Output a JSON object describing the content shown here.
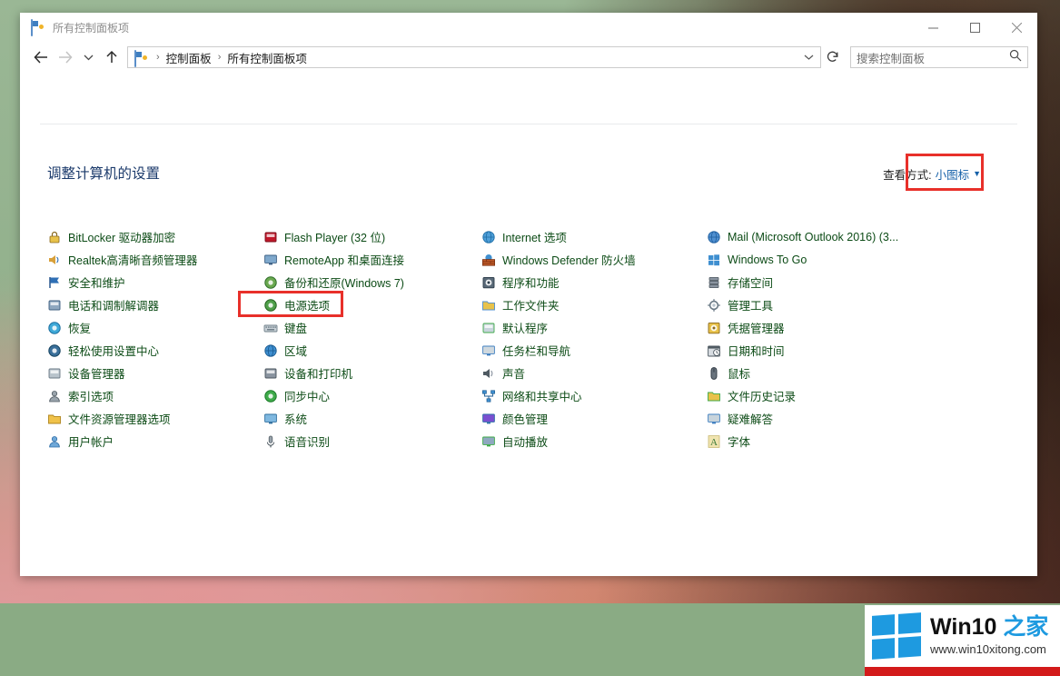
{
  "window": {
    "title": "所有控制面板项",
    "controls": {
      "minimize": "最小化",
      "maximize": "最大化",
      "close": "关闭"
    }
  },
  "nav": {
    "back": "后退",
    "forward": "前进",
    "recent": "最近浏览的位置",
    "up": "上移到",
    "breadcrumb": [
      "控制面板",
      "所有控制面板项"
    ],
    "separator": "›",
    "refresh": "刷新"
  },
  "search": {
    "placeholder": "搜索控制面板",
    "icon": "search-icon"
  },
  "header": {
    "page_title": "调整计算机的设置",
    "view_by_label": "查看方式:",
    "view_by_value": "小图标",
    "caret": "▼"
  },
  "highlight_color": "#e8302a",
  "items": {
    "column1": [
      "BitLocker 驱动器加密",
      "Realtek高清晰音频管理器",
      "安全和维护",
      "电话和调制解调器",
      "恢复",
      "轻松使用设置中心",
      "设备管理器",
      "索引选项",
      "文件资源管理器选项",
      "用户帐户"
    ],
    "column2": [
      "Flash Player (32 位)",
      "RemoteApp 和桌面连接",
      "备份和还原(Windows 7)",
      "电源选项",
      "键盘",
      "区域",
      "设备和打印机",
      "同步中心",
      "系统",
      "语音识别"
    ],
    "column3": [
      "Internet 选项",
      "Windows Defender 防火墙",
      "程序和功能",
      "工作文件夹",
      "默认程序",
      "任务栏和导航",
      "声音",
      "网络和共享中心",
      "颜色管理",
      "自动播放"
    ],
    "column4": [
      "Mail (Microsoft Outlook 2016) (3...",
      "Windows To Go",
      "存储空间",
      "管理工具",
      "凭据管理器",
      "日期和时间",
      "鼠标",
      "文件历史记录",
      "疑难解答",
      "字体"
    ]
  },
  "watermark": {
    "brand_main": "Win10 ",
    "brand_accent": "之家",
    "url": "www.win10xitong.com"
  }
}
